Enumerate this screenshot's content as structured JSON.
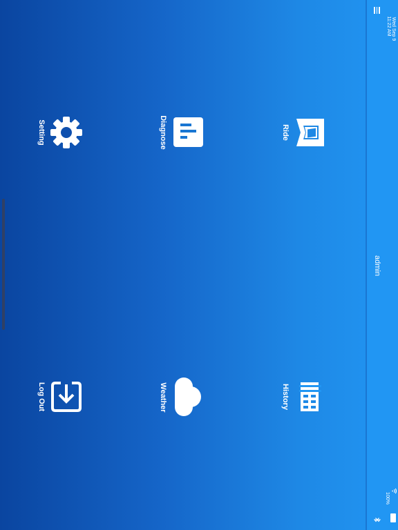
{
  "status_bar": {
    "time": "11:22 AM",
    "date": "Wed Sep 9",
    "battery": "100%"
  },
  "nav": {
    "title": "admin",
    "menu_icon": "hamburger-menu-icon"
  },
  "menu_items": [
    {
      "label": "Ride",
      "icon": "map-icon"
    },
    {
      "label": "History",
      "icon": "history-bars-icon"
    },
    {
      "label": "Diagnose",
      "icon": "document-report-icon"
    },
    {
      "label": "Weather",
      "icon": "cloud-icon"
    },
    {
      "label": "Setting",
      "icon": "gear-icon"
    },
    {
      "label": "Log Out",
      "icon": "logout-download-icon"
    }
  ],
  "colors": {
    "gradient_start": "#0a45a0",
    "gradient_end": "#2196f3",
    "navbar": "#2196f3",
    "icon": "#ffffff"
  }
}
